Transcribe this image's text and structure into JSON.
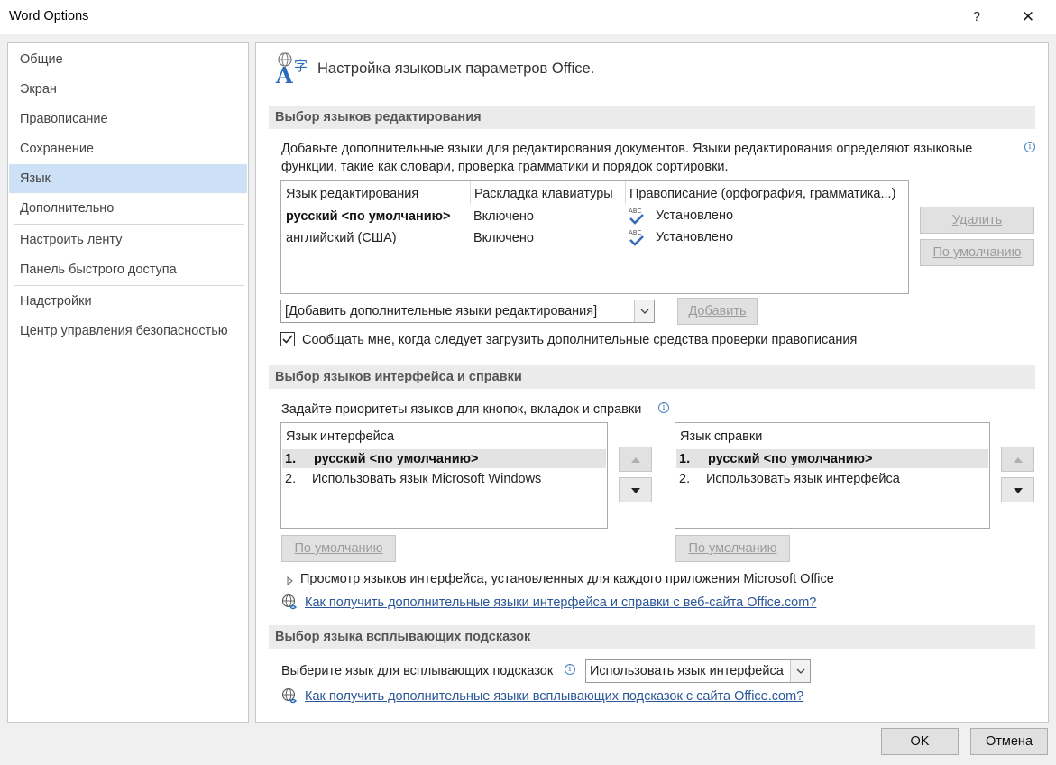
{
  "window": {
    "title": "Word Options",
    "help_glyph": "?",
    "close_glyph": "✕"
  },
  "sidebar": {
    "items": [
      {
        "label": "Общие"
      },
      {
        "label": "Экран"
      },
      {
        "label": "Правописание"
      },
      {
        "label": "Сохранение"
      },
      {
        "label": "Язык",
        "selected": true
      },
      {
        "label": "Дополнительно"
      },
      {
        "label": "Настроить ленту"
      },
      {
        "label": "Панель быстрого доступа"
      },
      {
        "label": "Надстройки"
      },
      {
        "label": "Центр управления безопасностью"
      }
    ]
  },
  "header": {
    "title": "Настройка языковых параметров Office.",
    "icon": "language-icon"
  },
  "editing": {
    "heading": "Выбор языков редактирования",
    "description_line1": "Добавьте дополнительные языки для редактирования документов. Языки редактирования определяют языковые",
    "description_line2": "функции, такие как словари, проверка грамматики и порядок сортировки.",
    "columns": [
      "Язык редактирования",
      "Раскладка клавиатуры",
      "Правописание (орфография, грамматика...)"
    ],
    "rows": [
      {
        "language": "русский <по умолчанию>",
        "keyboard": "Включено",
        "proofing": "Установлено",
        "bold": true
      },
      {
        "language": "английский (США)",
        "keyboard": "Включено",
        "proofing": "Установлено",
        "bold": false
      }
    ],
    "abc_label": "ABC",
    "remove_label": "Удалить",
    "default_label": "По умолчанию",
    "add_combo_value": "[Добавить дополнительные языки редактирования]",
    "add_label": "Добавить",
    "notify_checked": true,
    "notify_label": "Сообщать мне, когда следует загрузить дополнительные средства проверки правописания"
  },
  "display": {
    "heading": "Выбор языков интерфейса и справки",
    "description": "Задайте приоритеты языков для кнопок, вкладок и справки",
    "ui_header": "Язык интерфейса",
    "ui_items": [
      {
        "num": "1.",
        "label": "русский <по умолчанию>"
      },
      {
        "num": "2.",
        "label": "Использовать язык Microsoft Windows"
      }
    ],
    "help_header": "Язык справки",
    "help_items": [
      {
        "num": "1.",
        "label": "русский <по умолчанию>"
      },
      {
        "num": "2.",
        "label": "Использовать язык интерфейса"
      }
    ],
    "default_label": "По умолчанию",
    "view_label": "Просмотр языков интерфейса, установленных для каждого приложения Microsoft Office",
    "link": "Как получить дополнительные языки интерфейса и справки с веб-сайта Office.com?"
  },
  "screentip": {
    "heading": "Выбор языка всплывающих подсказок",
    "label": "Выберите язык для всплывающих подсказок",
    "combo_value": "Использовать язык интерфейса",
    "link": "Как получить дополнительные языки всплывающих подсказок с сайта Office.com?"
  },
  "footer": {
    "ok": "OK",
    "cancel": "Отмена"
  },
  "colors": {
    "accent": "#2b5797",
    "selected_nav": "#cce0f6",
    "section_bg": "#ebebeb"
  }
}
